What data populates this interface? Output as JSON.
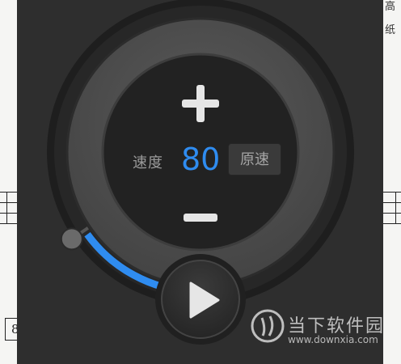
{
  "controls": {
    "speed_label": "速度",
    "speed_value": "80",
    "reset_label": "原速",
    "progress_fraction": 0.3
  },
  "background_page": {
    "side_text": [
      "高",
      "纸"
    ],
    "measure_number": "8"
  },
  "watermark": {
    "name": "当下软件园",
    "url": "www.downxia.com"
  },
  "colors": {
    "accent": "#2f8cf0",
    "panel": "#2e2e2e"
  },
  "icons": [
    "plus-icon",
    "minus-icon",
    "play-icon",
    "watermark-logo-icon"
  ]
}
